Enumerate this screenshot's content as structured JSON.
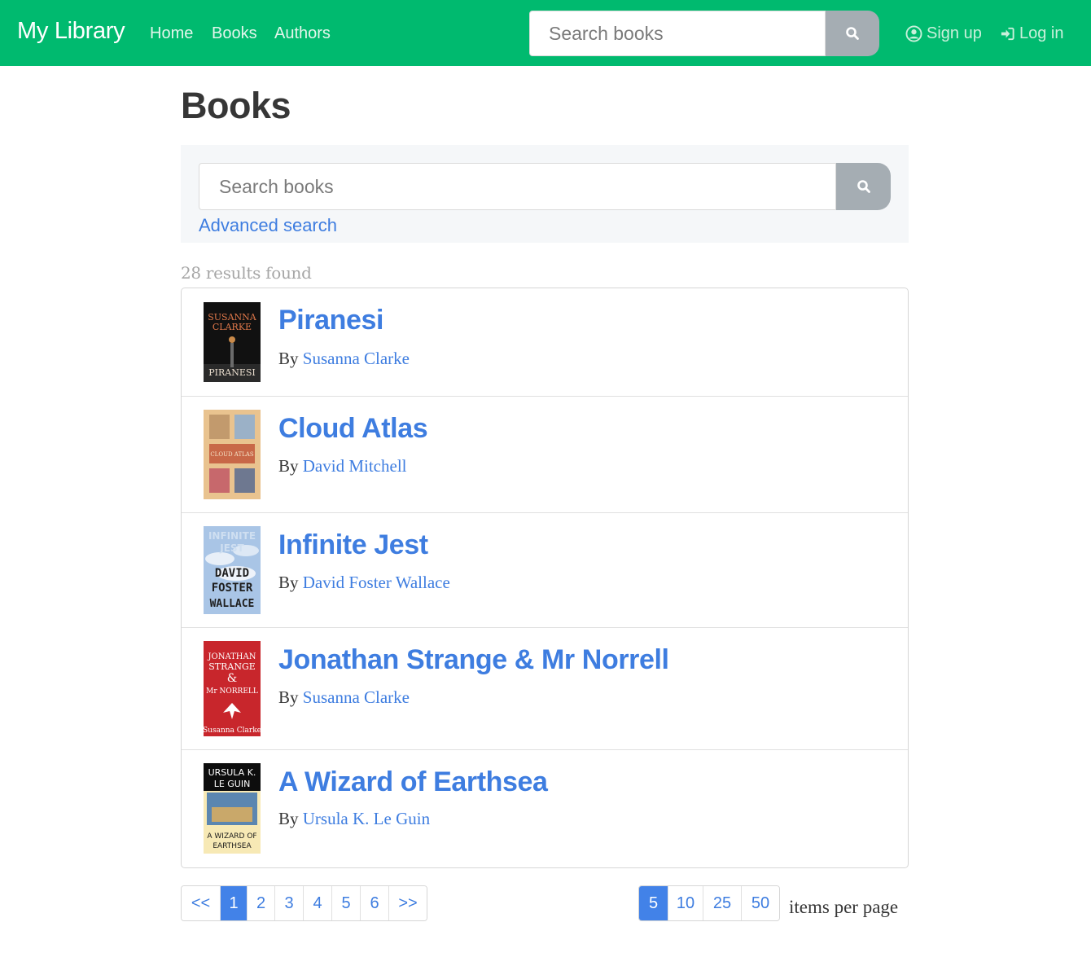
{
  "nav": {
    "brand": "My Library",
    "links": [
      "Home",
      "Books",
      "Authors"
    ],
    "search_placeholder": "Search books",
    "signup": "Sign up",
    "login": "Log in"
  },
  "page": {
    "title": "Books",
    "search_placeholder": "Search books",
    "advanced_search": "Advanced search",
    "results_count": "28 results found"
  },
  "books": [
    {
      "title": "Piranesi",
      "by": "By",
      "author": "Susanna Clarke",
      "cover_text": [
        "SUSANNA",
        "CLARKE",
        "PIRANESI"
      ]
    },
    {
      "title": "Cloud Atlas",
      "by": "By",
      "author": "David Mitchell",
      "cover_text": [
        "CLOUD ATLAS"
      ]
    },
    {
      "title": "Infinite Jest",
      "by": "By",
      "author": "David Foster Wallace",
      "cover_text": [
        "INFINITE",
        "JEST",
        "DAVID",
        "FOSTER",
        "WALLACE"
      ]
    },
    {
      "title": "Jonathan Strange & Mr Norrell",
      "by": "By",
      "author": "Susanna Clarke",
      "cover_text": [
        "JONATHAN",
        "STRANGE",
        "&",
        "Mr NORRELL",
        "Susanna Clarke"
      ]
    },
    {
      "title": "A Wizard of Earthsea",
      "by": "By",
      "author": "Ursula K. Le Guin",
      "cover_text": [
        "URSULA K.",
        "LE GUIN",
        "A WIZARD OF",
        "EARTHSEA"
      ]
    }
  ],
  "pagination": {
    "prev": "<<",
    "pages": [
      "1",
      "2",
      "3",
      "4",
      "5",
      "6"
    ],
    "current": "1",
    "next": ">>"
  },
  "per_page": {
    "options": [
      "5",
      "10",
      "25",
      "50"
    ],
    "selected": "5",
    "label": "items per page"
  },
  "colors": {
    "navbar": "#00ba6f",
    "link": "#3e7de0",
    "active": "#4282e8",
    "search_button": "#a5adb3"
  }
}
